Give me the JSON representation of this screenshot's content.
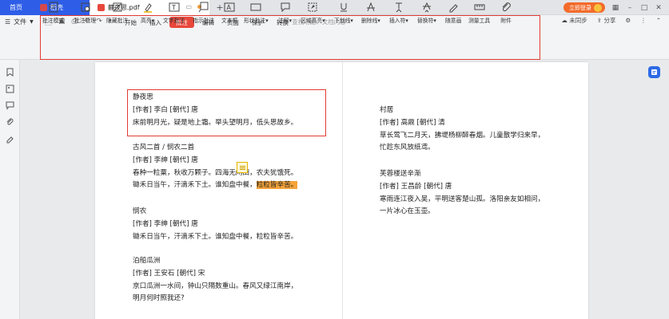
{
  "tabs": {
    "home": "首页",
    "daoke": "稻壳",
    "doc": "静夜思.pdf",
    "plus": "+"
  },
  "window": {
    "login": "立即登录"
  },
  "menubar": {
    "file": "文件",
    "items": [
      "开始",
      "插入",
      "批注",
      "编辑",
      "页面",
      "保护",
      "转换"
    ],
    "active_index": 2,
    "search_placeholder": "查找功能、文档内容",
    "unsynced": "未同步",
    "share": "分享"
  },
  "left_tools": {
    "hand": "手型",
    "select": "选择"
  },
  "ribbon": [
    "批注模式",
    "批注管理",
    "隐藏批注",
    "高亮",
    "文字批注",
    "指示批注",
    "文本框",
    "形状批注",
    "注解",
    "区域高亮",
    "下划线",
    "删除线",
    "插入符",
    "替换符",
    "随意画",
    "测量工具",
    "附件"
  ],
  "poems_left": [
    {
      "title": "静夜思",
      "author": "[作者] 李白 [朝代] 唐",
      "lines": [
        "床前明月光，疑是地上霜。举头望明月，低头思故乡。"
      ]
    },
    {
      "title": "古风二首 / 悯农二首",
      "author": "[作者] 李绅 [朝代] 唐",
      "lines": [
        "春种一粒粟，秋收万颗子。四海无闲田，农夫犹饿死。",
        "锄禾日当午，汗滴禾下土。谁知盘中餐，"
      ],
      "highlight": "粒粒皆辛苦。"
    },
    {
      "title": "悯农",
      "author": "[作者] 李绅 [朝代] 唐",
      "lines": [
        "锄禾日当午，汗滴禾下土。谁知盘中餐，粒粒皆辛苦。"
      ]
    },
    {
      "title": "泊船瓜洲",
      "author": "[作者] 王安石 [朝代] 宋",
      "lines": [
        "京口瓜洲一水间，钟山只隔数重山。春风又绿江南岸，",
        "明月何时照我还?"
      ]
    }
  ],
  "poems_right": [
    {
      "title": "村居",
      "author": "[作者] 高鼎 [朝代] 清",
      "lines": [
        "草长莺飞二月天，拂堤杨柳醉春烟。儿童散学归来早，",
        "忙趁东风放纸鸢。"
      ]
    },
    {
      "title": "芙蓉楼送辛渐",
      "author": "[作者] 王昌龄 [朝代] 唐",
      "lines": [
        "寒雨连江夜入吴，平明送客楚山孤。洛阳亲友如相问，",
        "一片冰心在玉壶。"
      ]
    }
  ],
  "colors": {
    "accent_blue": "#2e5ee8",
    "annotation_red": "#e23b33",
    "highlight": "#f5a43a"
  }
}
